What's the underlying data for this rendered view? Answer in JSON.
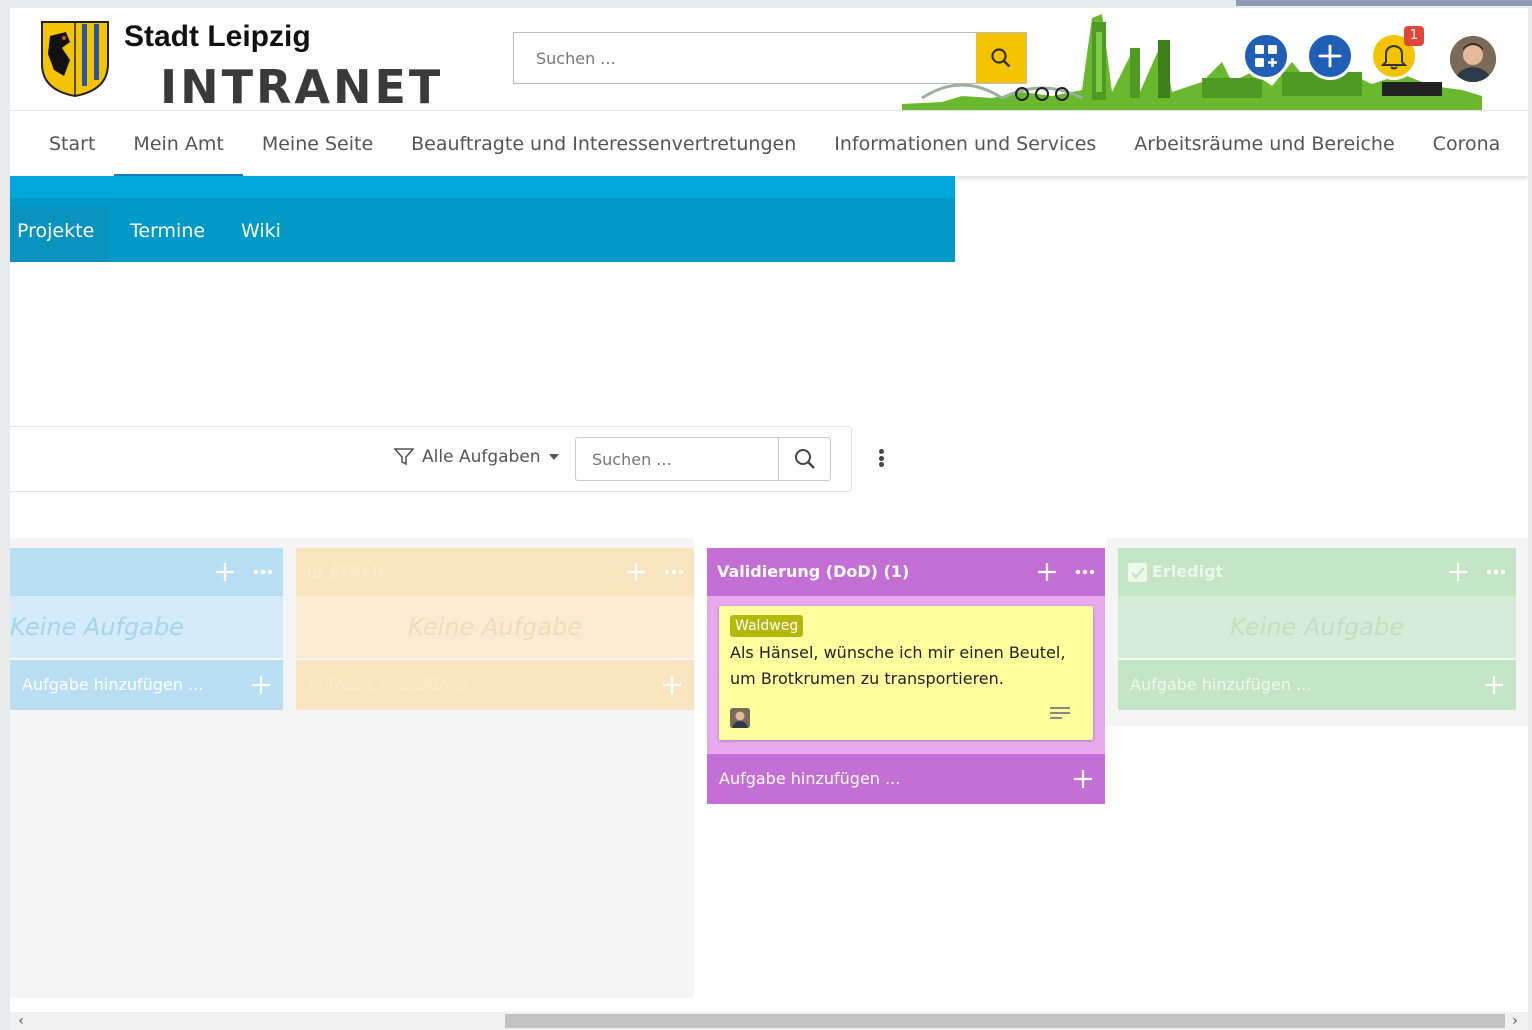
{
  "header": {
    "brand_city": "Stadt Leipzig",
    "brand_intranet": "INTRANET",
    "search_placeholder": "Suchen ...",
    "notification_count": "1"
  },
  "main_nav": {
    "items": [
      "Start",
      "Mein Amt",
      "Meine Seite",
      "Beauftragte und Interessenvertretungen",
      "Informationen und Services",
      "Arbeitsräume und Bereiche",
      "Corona"
    ],
    "active": "Mein Amt"
  },
  "sub_nav": {
    "items": [
      "Projekte",
      "Termine",
      "Wiki"
    ],
    "active": "Projekte"
  },
  "toolbar": {
    "filter_label": "Alle Aufgaben",
    "search_placeholder": "Suchen ..."
  },
  "board": {
    "columns": [
      {
        "title": "",
        "empty_text": "Keine Aufgabe",
        "add_label": "Aufgabe hinzufügen ...",
        "color": "#b9dff5"
      },
      {
        "title": "In Arbeit",
        "empty_text": "Keine Aufgabe",
        "add_label": "Aufgabe hinzufügen ...",
        "color": "#f9e5bf"
      },
      {
        "title": "Validierung (DoD) (1)",
        "add_label": "Aufgabe hinzufügen ...",
        "color": "#c46fd6"
      },
      {
        "title": "Erledigt",
        "empty_text": "Keine Aufgabe",
        "add_label": "Aufgabe hinzufügen ...",
        "color": "#c5e5c7"
      }
    ],
    "card": {
      "tag": "Waldweg",
      "title": "Als Hänsel, wünsche ich mir einen Beutel, um Brotkrumen zu transportieren."
    }
  },
  "colors": {
    "accent_blue": "#0099c8",
    "brand_yellow": "#f5c400",
    "brand_blue": "#1f5fb5"
  }
}
